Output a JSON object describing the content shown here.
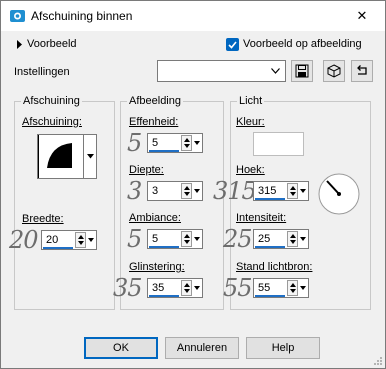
{
  "window": {
    "title": "Afschuining binnen",
    "close_symbol": "✕"
  },
  "preview": {
    "toggle_label": "Voorbeeld",
    "preview_on_image_label": "Voorbeeld op afbeelding",
    "preview_on_image_checked": true
  },
  "settings": {
    "label": "Instellingen",
    "value": ""
  },
  "bevel": {
    "group_title": "Afschuining",
    "shape_label": "Afschuining:",
    "width_label": "Breedte:",
    "width_value": "20",
    "width_ghost": "20"
  },
  "image": {
    "group_title": "Afbeelding",
    "smoothness_label": "Effenheid:",
    "smoothness_value": "5",
    "smoothness_ghost": "5",
    "depth_label": "Diepte:",
    "depth_value": "3",
    "depth_ghost": "3",
    "ambience_label": "Ambiance:",
    "ambience_value": "5",
    "ambience_ghost": "5",
    "shininess_label": "Glinstering:",
    "shininess_value": "35",
    "shininess_ghost": "35"
  },
  "light": {
    "group_title": "Licht",
    "color_label": "Kleur:",
    "color_value": "#ffffff",
    "angle_label": "Hoek:",
    "angle_value": "315",
    "angle_ghost": "315",
    "intensity_label": "Intensiteit:",
    "intensity_value": "25",
    "intensity_ghost": "25",
    "elevation_label": "Stand lichtbron:",
    "elevation_value": "55",
    "elevation_ghost": "55"
  },
  "buttons": {
    "ok": "OK",
    "cancel": "Annuleren",
    "help": "Help"
  },
  "colors": {
    "accent": "#0067c0",
    "window_bg": "#f0f0f0",
    "bar_blue": "#1f6fc5"
  }
}
